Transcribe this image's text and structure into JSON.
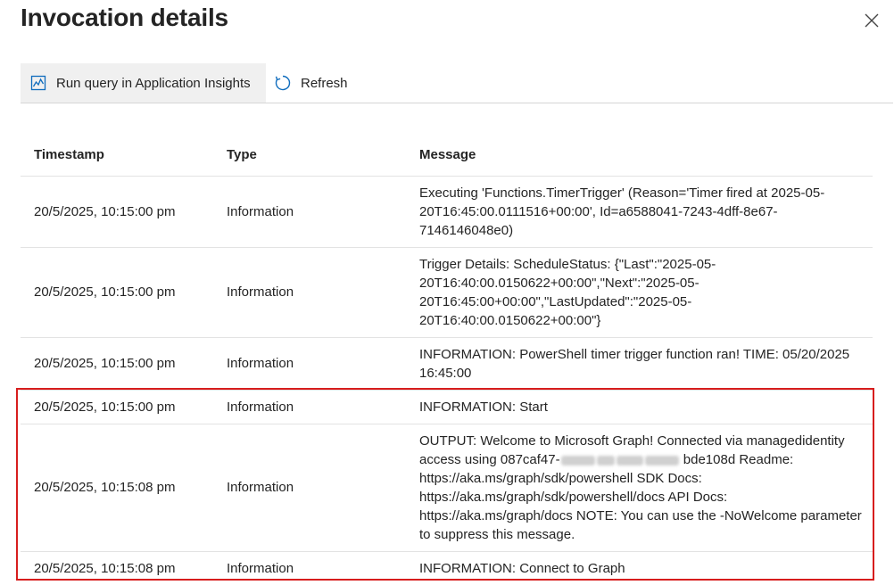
{
  "panel": {
    "title": "Invocation details"
  },
  "toolbar": {
    "run_query_label": "Run query in Application Insights",
    "refresh_label": "Refresh"
  },
  "table": {
    "headers": {
      "timestamp": "Timestamp",
      "type": "Type",
      "message": "Message"
    },
    "rows": [
      {
        "timestamp": "20/5/2025, 10:15:00 pm",
        "type": "Information",
        "message": "Executing 'Functions.TimerTrigger' (Reason='Timer fired at 2025-05-20T16:45:00.0111516+00:00', Id=a6588041-7243-4dff-8e67-7146146048e0)"
      },
      {
        "timestamp": "20/5/2025, 10:15:00 pm",
        "type": "Information",
        "message": "Trigger Details: ScheduleStatus: {\"Last\":\"2025-05-20T16:40:00.0150622+00:00\",\"Next\":\"2025-05-20T16:45:00+00:00\",\"LastUpdated\":\"2025-05-20T16:40:00.0150622+00:00\"}"
      },
      {
        "timestamp": "20/5/2025, 10:15:00 pm",
        "type": "Information",
        "message": "INFORMATION: PowerShell timer trigger function ran! TIME: 05/20/2025 16:45:00"
      },
      {
        "timestamp": "20/5/2025, 10:15:00 pm",
        "type": "Information",
        "message": "INFORMATION: Start"
      },
      {
        "timestamp": "20/5/2025, 10:15:08 pm",
        "type": "Information",
        "message_line1": "OUTPUT: Welcome to Microsoft Graph! Connected via managedidentity access using 087caf47-",
        "message_line2": "bde108d Readme: https://aka.ms/graph/sdk/powershell SDK Docs: https://aka.ms/graph/sdk/powershell/docs API Docs: https://aka.ms/graph/docs NOTE: You can use the -NoWelcome parameter to suppress this message."
      },
      {
        "timestamp": "20/5/2025, 10:15:08 pm",
        "type": "Information",
        "message": "INFORMATION: Connect to Graph"
      }
    ]
  },
  "colors": {
    "highlight_border": "#d71d1d",
    "accent_blue": "#0f6cbd"
  },
  "icons": {
    "run_query": "chart-line-icon",
    "refresh": "refresh-icon",
    "close": "close-icon"
  }
}
